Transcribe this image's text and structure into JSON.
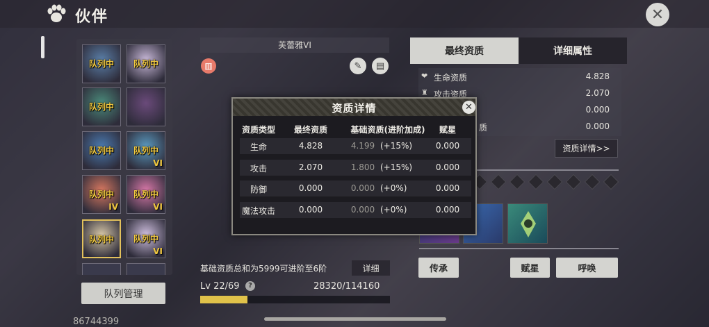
{
  "header": {
    "title": "伙伴"
  },
  "roster": {
    "cards": [
      {
        "tag": "队列中",
        "grade": "",
        "selected": false,
        "color": "#5a7fa8"
      },
      {
        "tag": "队列中",
        "grade": "",
        "selected": false,
        "color": "#c8b8d8"
      },
      {
        "tag": "队列中",
        "grade": "",
        "selected": false,
        "color": "#4a8a7a"
      },
      {
        "tag": "",
        "grade": "",
        "selected": false,
        "color": "#6a4a7a"
      },
      {
        "tag": "队列中",
        "grade": "",
        "selected": false,
        "color": "#4a7ab0"
      },
      {
        "tag": "队列中",
        "grade": "VI",
        "selected": false,
        "color": "#5a9ac0"
      },
      {
        "tag": "队列中",
        "grade": "IV",
        "selected": false,
        "color": "#d87860"
      },
      {
        "tag": "队列中",
        "grade": "VI",
        "selected": false,
        "color": "#d878a8"
      },
      {
        "tag": "队列中",
        "grade": "",
        "selected": true,
        "color": "#d8c8a8"
      },
      {
        "tag": "队列中",
        "grade": "VI",
        "selected": false,
        "color": "#d0c0e0"
      }
    ],
    "manage_label": "队列管理",
    "user_id": "86744399"
  },
  "center": {
    "character_name": "芙蕾雅VI",
    "advance_text": "基础资质总和为5999可进阶至6阶",
    "detail_label": "详细",
    "level_text": "Lv 22/69",
    "help_glyph": "?",
    "exp_text": "28320/114160",
    "exp_fraction": 0.248
  },
  "right": {
    "tab_final": "最终资质",
    "tab_detail": "详细属性",
    "stats": [
      {
        "icon": "❤",
        "name": "生命资质",
        "value": "4.828"
      },
      {
        "icon": "♜",
        "name": "攻击资质",
        "value": "2.070"
      },
      {
        "icon": "",
        "name": "",
        "value": "0.000"
      },
      {
        "icon": "",
        "name": "质",
        "value": "0.000"
      }
    ],
    "quality_detail_label": "资质详情>>",
    "inherit_label": "传承",
    "star_label": "赋星",
    "summon_label": "呼唤"
  },
  "modal": {
    "title": "资质详情",
    "headers": [
      "资质类型",
      "最终资质",
      "基础资质(进阶加成)",
      "赋星"
    ],
    "rows": [
      {
        "type": "生命",
        "final": "4.828",
        "base": "4.199",
        "bonus": "(+15%)",
        "star": "0.000"
      },
      {
        "type": "攻击",
        "final": "2.070",
        "base": "1.800",
        "bonus": "(+15%)",
        "star": "0.000"
      },
      {
        "type": "防御",
        "final": "0.000",
        "base": "0.000",
        "bonus": "(+0%)",
        "star": "0.000"
      },
      {
        "type": "魔法攻击",
        "final": "0.000",
        "base": "0.000",
        "bonus": "(+0%)",
        "star": "0.000"
      }
    ]
  },
  "colors": {
    "accent_gold": "#e0c24a",
    "tab_active": "#d4d4d0",
    "modal_bg": "#1c1b20"
  }
}
